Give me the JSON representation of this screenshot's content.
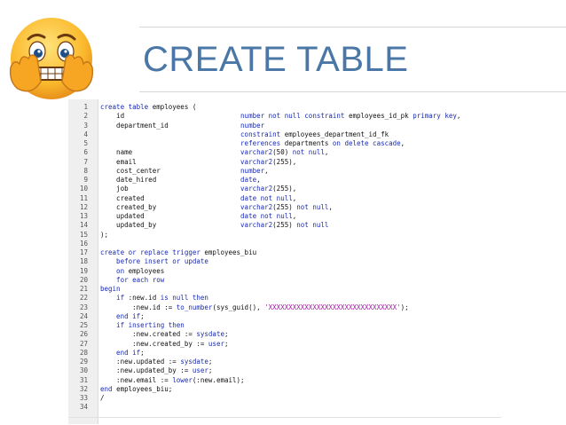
{
  "slide": {
    "title": "CREATE TABLE",
    "emoji_icon": "scared-face-emoji-icon",
    "title_color": "#4a77a6"
  },
  "code": {
    "lines": [
      [
        {
          "t": "create table ",
          "k": "kw"
        },
        {
          "t": "employees (",
          "k": ""
        }
      ],
      [
        {
          "t": "    id                             ",
          "k": ""
        },
        {
          "t": "number not null constraint ",
          "k": "kw"
        },
        {
          "t": "employees_id_pk ",
          "k": ""
        },
        {
          "t": "primary key",
          "k": "kw"
        },
        {
          "t": ",",
          "k": ""
        }
      ],
      [
        {
          "t": "    department_id                  ",
          "k": ""
        },
        {
          "t": "number",
          "k": "kw"
        }
      ],
      [
        {
          "t": "                                   ",
          "k": ""
        },
        {
          "t": "constraint ",
          "k": "kw"
        },
        {
          "t": "employees_department_id_fk",
          "k": ""
        }
      ],
      [
        {
          "t": "                                   ",
          "k": ""
        },
        {
          "t": "references ",
          "k": "kw"
        },
        {
          "t": "departments ",
          "k": ""
        },
        {
          "t": "on delete cascade",
          "k": "kw"
        },
        {
          "t": ",",
          "k": ""
        }
      ],
      [
        {
          "t": "    name                           ",
          "k": ""
        },
        {
          "t": "varchar2",
          "k": "kw"
        },
        {
          "t": "(50) ",
          "k": ""
        },
        {
          "t": "not null",
          "k": "kw"
        },
        {
          "t": ",",
          "k": ""
        }
      ],
      [
        {
          "t": "    email                          ",
          "k": ""
        },
        {
          "t": "varchar2",
          "k": "kw"
        },
        {
          "t": "(255),",
          "k": ""
        }
      ],
      [
        {
          "t": "    cost_center                    ",
          "k": ""
        },
        {
          "t": "number",
          "k": "kw"
        },
        {
          "t": ",",
          "k": ""
        }
      ],
      [
        {
          "t": "    date_hired                     ",
          "k": ""
        },
        {
          "t": "date",
          "k": "kw"
        },
        {
          "t": ",",
          "k": ""
        }
      ],
      [
        {
          "t": "    job                            ",
          "k": ""
        },
        {
          "t": "varchar2",
          "k": "kw"
        },
        {
          "t": "(255),",
          "k": ""
        }
      ],
      [
        {
          "t": "    created                        ",
          "k": ""
        },
        {
          "t": "date not null",
          "k": "kw"
        },
        {
          "t": ",",
          "k": ""
        }
      ],
      [
        {
          "t": "    created_by                     ",
          "k": ""
        },
        {
          "t": "varchar2",
          "k": "kw"
        },
        {
          "t": "(255) ",
          "k": ""
        },
        {
          "t": "not null",
          "k": "kw"
        },
        {
          "t": ",",
          "k": ""
        }
      ],
      [
        {
          "t": "    updated                        ",
          "k": ""
        },
        {
          "t": "date not null",
          "k": "kw"
        },
        {
          "t": ",",
          "k": ""
        }
      ],
      [
        {
          "t": "    updated_by                     ",
          "k": ""
        },
        {
          "t": "varchar2",
          "k": "kw"
        },
        {
          "t": "(255) ",
          "k": ""
        },
        {
          "t": "not null",
          "k": "kw"
        }
      ],
      [
        {
          "t": ");",
          "k": ""
        }
      ],
      [
        {
          "t": "",
          "k": ""
        }
      ],
      [
        {
          "t": "create or replace trigger ",
          "k": "kw"
        },
        {
          "t": "employees_biu",
          "k": ""
        }
      ],
      [
        {
          "t": "    before insert or update",
          "k": "kw"
        }
      ],
      [
        {
          "t": "    on ",
          "k": "kw"
        },
        {
          "t": "employees",
          "k": ""
        }
      ],
      [
        {
          "t": "    for each row",
          "k": "kw"
        }
      ],
      [
        {
          "t": "begin",
          "k": "kw"
        }
      ],
      [
        {
          "t": "    if ",
          "k": "kw"
        },
        {
          "t": ":new.id ",
          "k": ""
        },
        {
          "t": "is null then",
          "k": "kw"
        }
      ],
      [
        {
          "t": "        :new.id := ",
          "k": ""
        },
        {
          "t": "to_number",
          "k": "kw"
        },
        {
          "t": "(sys_guid(), ",
          "k": ""
        },
        {
          "t": "'XXXXXXXXXXXXXXXXXXXXXXXXXXXXXXXX'",
          "k": "str"
        },
        {
          "t": ");",
          "k": ""
        }
      ],
      [
        {
          "t": "    end if",
          "k": "kw"
        },
        {
          "t": ";",
          "k": ""
        }
      ],
      [
        {
          "t": "    if inserting then",
          "k": "kw"
        }
      ],
      [
        {
          "t": "        :new.created := ",
          "k": ""
        },
        {
          "t": "sysdate",
          "k": "kw"
        },
        {
          "t": ";",
          "k": ""
        }
      ],
      [
        {
          "t": "        :new.created_by := ",
          "k": ""
        },
        {
          "t": "user",
          "k": "kw"
        },
        {
          "t": ";",
          "k": ""
        }
      ],
      [
        {
          "t": "    end if",
          "k": "kw"
        },
        {
          "t": ";",
          "k": ""
        }
      ],
      [
        {
          "t": "    :new.updated := ",
          "k": ""
        },
        {
          "t": "sysdate",
          "k": "kw"
        },
        {
          "t": ";",
          "k": ""
        }
      ],
      [
        {
          "t": "    :new.updated_by := ",
          "k": ""
        },
        {
          "t": "user",
          "k": "kw"
        },
        {
          "t": ";",
          "k": ""
        }
      ],
      [
        {
          "t": "    :new.email := ",
          "k": ""
        },
        {
          "t": "lower",
          "k": "kw"
        },
        {
          "t": "(:new.email);",
          "k": ""
        }
      ],
      [
        {
          "t": "end ",
          "k": "kw"
        },
        {
          "t": "employees_biu;",
          "k": ""
        }
      ],
      [
        {
          "t": "/",
          "k": ""
        }
      ],
      [
        {
          "t": "",
          "k": ""
        }
      ]
    ]
  }
}
